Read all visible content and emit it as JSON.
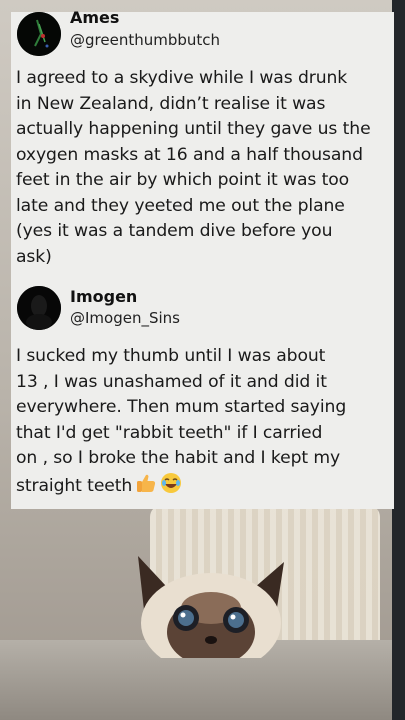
{
  "tweets": [
    {
      "display_name": "Ames",
      "handle": "@greenthumbbutch",
      "text": "I agreed to a skydive while I was drunk\nin New Zealand, didn’t realise it was\nactually happening until they gave us the\noxygen masks at 16 and a half thousand\nfeet in the air by which point it was too\nlate and they yeeted me out the plane\n(yes it was a tandem dive before you\nask)"
    },
    {
      "display_name": "Imogen",
      "handle": "@Imogen_Sins",
      "text": "I sucked my thumb until I was about\n13 , I was unashamed of it and did it\neverywhere. Then mum started saying\nthat I'd get \"rabbit teeth\" if I carried\non , so I broke the habit and I kept my\nstraight teeth",
      "emojis": [
        "thumbs-up-icon",
        "laughing-icon"
      ]
    }
  ],
  "colors": {
    "card_bg": "#eeeeec",
    "text": "#1a1a1a",
    "avatar_bg": "#060806"
  }
}
